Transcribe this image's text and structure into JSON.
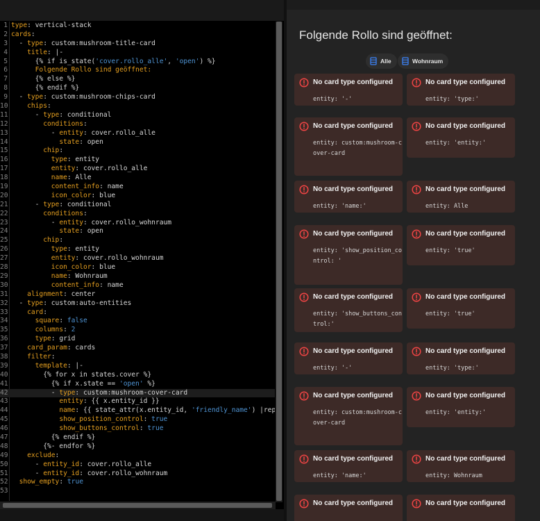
{
  "editor": {
    "lines": [
      [
        [
          "type",
          "k"
        ],
        [
          ": vertical-stack",
          "v"
        ]
      ],
      [
        [
          "cards",
          "k"
        ],
        [
          ":",
          "v"
        ]
      ],
      [
        [
          "  - ",
          "v"
        ],
        [
          "type",
          "k"
        ],
        [
          ": custom:mushroom-title-card",
          "v"
        ]
      ],
      [
        [
          "    ",
          "v"
        ],
        [
          "title",
          "k"
        ],
        [
          ": |-",
          "v"
        ]
      ],
      [
        [
          "      {% if is_state(",
          "v"
        ],
        [
          "'cover.rollo_alle'",
          "s"
        ],
        [
          ", ",
          "v"
        ],
        [
          "'open'",
          "s"
        ],
        [
          ") %}",
          "v"
        ]
      ],
      [
        [
          "      Folgende Rollo sind geöffnet:",
          "c"
        ]
      ],
      [
        [
          "      {% else %}",
          "v"
        ]
      ],
      [
        [
          "      {% endif %}",
          "v"
        ]
      ],
      [
        [
          "  - ",
          "v"
        ],
        [
          "type",
          "k"
        ],
        [
          ": custom:mushroom-chips-card",
          "v"
        ]
      ],
      [
        [
          "    ",
          "v"
        ],
        [
          "chips",
          "k"
        ],
        [
          ":",
          "v"
        ]
      ],
      [
        [
          "      - ",
          "v"
        ],
        [
          "type",
          "k"
        ],
        [
          ": conditional",
          "v"
        ]
      ],
      [
        [
          "        ",
          "v"
        ],
        [
          "conditions",
          "k"
        ],
        [
          ":",
          "v"
        ]
      ],
      [
        [
          "          - ",
          "v"
        ],
        [
          "entity",
          "k"
        ],
        [
          ": cover.rollo_alle",
          "v"
        ]
      ],
      [
        [
          "            ",
          "v"
        ],
        [
          "state",
          "k"
        ],
        [
          ": open",
          "v"
        ]
      ],
      [
        [
          "        ",
          "v"
        ],
        [
          "chip",
          "k"
        ],
        [
          ":",
          "v"
        ]
      ],
      [
        [
          "          ",
          "v"
        ],
        [
          "type",
          "k"
        ],
        [
          ": entity",
          "v"
        ]
      ],
      [
        [
          "          ",
          "v"
        ],
        [
          "entity",
          "k"
        ],
        [
          ": cover.rollo_alle",
          "v"
        ]
      ],
      [
        [
          "          ",
          "v"
        ],
        [
          "name",
          "k"
        ],
        [
          ": Alle",
          "v"
        ]
      ],
      [
        [
          "          ",
          "v"
        ],
        [
          "content_info",
          "k"
        ],
        [
          ": name",
          "v"
        ]
      ],
      [
        [
          "          ",
          "v"
        ],
        [
          "icon_color",
          "k"
        ],
        [
          ": blue",
          "v"
        ]
      ],
      [
        [
          "      - ",
          "v"
        ],
        [
          "type",
          "k"
        ],
        [
          ": conditional",
          "v"
        ]
      ],
      [
        [
          "        ",
          "v"
        ],
        [
          "conditions",
          "k"
        ],
        [
          ":",
          "v"
        ]
      ],
      [
        [
          "          - ",
          "v"
        ],
        [
          "entity",
          "k"
        ],
        [
          ": cover.rollo_wohnraum",
          "v"
        ]
      ],
      [
        [
          "            ",
          "v"
        ],
        [
          "state",
          "k"
        ],
        [
          ": open",
          "v"
        ]
      ],
      [
        [
          "        ",
          "v"
        ],
        [
          "chip",
          "k"
        ],
        [
          ":",
          "v"
        ]
      ],
      [
        [
          "          ",
          "v"
        ],
        [
          "type",
          "k"
        ],
        [
          ": entity",
          "v"
        ]
      ],
      [
        [
          "          ",
          "v"
        ],
        [
          "entity",
          "k"
        ],
        [
          ": cover.rollo_wohnraum",
          "v"
        ]
      ],
      [
        [
          "          ",
          "v"
        ],
        [
          "icon_color",
          "k"
        ],
        [
          ": blue",
          "v"
        ]
      ],
      [
        [
          "          ",
          "v"
        ],
        [
          "name",
          "k"
        ],
        [
          ": Wohnraum",
          "v"
        ]
      ],
      [
        [
          "          ",
          "v"
        ],
        [
          "content_info",
          "k"
        ],
        [
          ": name",
          "v"
        ]
      ],
      [
        [
          "    ",
          "v"
        ],
        [
          "alignment",
          "k"
        ],
        [
          ": center",
          "v"
        ]
      ],
      [
        [
          "  - ",
          "v"
        ],
        [
          "type",
          "k"
        ],
        [
          ": custom:auto-entities",
          "v"
        ]
      ],
      [
        [
          "    ",
          "v"
        ],
        [
          "card",
          "k"
        ],
        [
          ":",
          "v"
        ]
      ],
      [
        [
          "      ",
          "v"
        ],
        [
          "square",
          "k"
        ],
        [
          ": ",
          "v"
        ],
        [
          "false",
          "s"
        ]
      ],
      [
        [
          "      ",
          "v"
        ],
        [
          "columns",
          "k"
        ],
        [
          ": ",
          "v"
        ],
        [
          "2",
          "s"
        ]
      ],
      [
        [
          "      ",
          "v"
        ],
        [
          "type",
          "k"
        ],
        [
          ": grid",
          "v"
        ]
      ],
      [
        [
          "    ",
          "v"
        ],
        [
          "card_param",
          "k"
        ],
        [
          ": cards",
          "v"
        ]
      ],
      [
        [
          "    ",
          "v"
        ],
        [
          "filter",
          "k"
        ],
        [
          ":",
          "v"
        ]
      ],
      [
        [
          "      ",
          "v"
        ],
        [
          "template",
          "k"
        ],
        [
          ": |-",
          "v"
        ]
      ],
      [
        [
          "        {% for x in states.cover %}",
          "v"
        ]
      ],
      [
        [
          "          {% if x.state == ",
          "v"
        ],
        [
          "'open'",
          "s"
        ],
        [
          " %}",
          "v"
        ]
      ],
      [
        [
          "          - ",
          "v"
        ],
        [
          "type",
          "k"
        ],
        [
          ": custom:mushroom-cover-card",
          "v"
        ]
      ],
      [
        [
          "            ",
          "v"
        ],
        [
          "entity",
          "k"
        ],
        [
          ": {{ x.entity_id }}",
          "v"
        ]
      ],
      [
        [
          "            ",
          "v"
        ],
        [
          "name",
          "k"
        ],
        [
          ": {{ state_attr(x.entity_id, ",
          "v"
        ],
        [
          "'friendly_name'",
          "s"
        ],
        [
          ") |replace(",
          "v"
        ]
      ],
      [
        [
          "            ",
          "v"
        ],
        [
          "show_position_control",
          "k"
        ],
        [
          ": ",
          "v"
        ],
        [
          "true",
          "s"
        ]
      ],
      [
        [
          "            ",
          "v"
        ],
        [
          "show_buttons_control",
          "k"
        ],
        [
          ": ",
          "v"
        ],
        [
          "true",
          "s"
        ]
      ],
      [
        [
          "          {% endif %}",
          "v"
        ]
      ],
      [
        [
          "        {%- endfor %}",
          "v"
        ]
      ],
      [
        [
          "    ",
          "v"
        ],
        [
          "exclude",
          "k"
        ],
        [
          ":",
          "v"
        ]
      ],
      [
        [
          "      - ",
          "v"
        ],
        [
          "entity_id",
          "k"
        ],
        [
          ": cover.rollo_alle",
          "v"
        ]
      ],
      [
        [
          "      - ",
          "v"
        ],
        [
          "entity_id",
          "k"
        ],
        [
          ": cover.rollo_wohnraum",
          "v"
        ]
      ],
      [
        [
          "  ",
          "v"
        ],
        [
          "show_empty",
          "k"
        ],
        [
          ": ",
          "v"
        ],
        [
          "true",
          "s"
        ]
      ],
      [
        [
          "",
          "v"
        ]
      ]
    ],
    "active_line": 42
  },
  "preview": {
    "title": "Folgende Rollo sind geöffnet:",
    "chips": [
      {
        "icon": "window-shutter-icon",
        "label": "Alle"
      },
      {
        "icon": "window-shutter-icon",
        "label": "Wohnraum"
      }
    ],
    "error_title": "No card type configured",
    "cards": [
      {
        "body": "entity: '-'"
      },
      {
        "body": "entity: 'type:'"
      },
      {
        "body": "entity: custom:mushroom-cover-card"
      },
      {
        "body": "entity: 'entity:'"
      },
      {
        "body": "entity: 'name:'"
      },
      {
        "body": "entity: Alle"
      },
      {
        "body": "entity: 'show_position_control: '"
      },
      {
        "body": "entity: 'true'"
      },
      {
        "body": "entity: 'show_buttons_control:'"
      },
      {
        "body": "entity: 'true'"
      },
      {
        "body": "entity: '-'"
      },
      {
        "body": "entity: 'type:'"
      },
      {
        "body": "entity: custom:mushroom-cover-card"
      },
      {
        "body": "entity: 'entity:'"
      },
      {
        "body": "entity: 'name:'"
      },
      {
        "body": "entity: Wohnraum"
      },
      {
        "body": ""
      },
      {
        "body": ""
      }
    ]
  },
  "colors": {
    "key": "#e6a020",
    "string": "#4f94d4",
    "error_card_bg": "#3d2a27",
    "error_icon": "#ef4444",
    "chip_icon": "#3b82f6"
  }
}
